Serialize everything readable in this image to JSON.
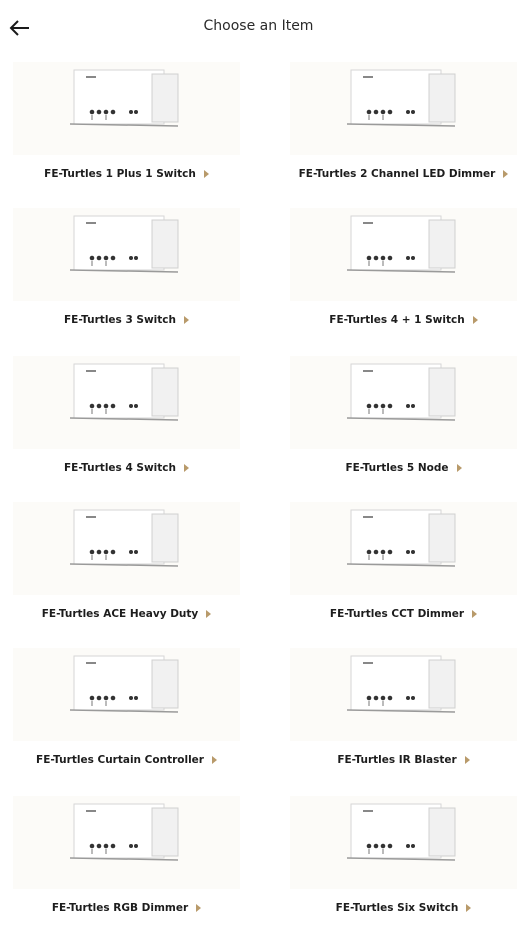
{
  "header": {
    "title": "Choose an Item",
    "back_icon": "arrow-left-icon"
  },
  "items": [
    {
      "label": "FE-Turtles 1 Plus 1 Switch"
    },
    {
      "label": "FE-Turtles 2 Channel LED Dimmer"
    },
    {
      "label": "FE-Turtles 3 Switch"
    },
    {
      "label": "FE-Turtles 4 + 1 Switch"
    },
    {
      "label": "FE-Turtles 4 Switch"
    },
    {
      "label": "FE-Turtles 5 Node"
    },
    {
      "label": "FE-Turtles ACE Heavy Duty"
    },
    {
      "label": "FE-Turtles CCT Dimmer"
    },
    {
      "label": "FE-Turtles Curtain Controller"
    },
    {
      "label": "FE-Turtles IR Blaster"
    },
    {
      "label": "FE-Turtles RGB Dimmer"
    },
    {
      "label": "FE-Turtles Six Switch"
    }
  ],
  "colors": {
    "accent_arrow": "#b89a6a",
    "card_background": "#fcfbf8"
  }
}
